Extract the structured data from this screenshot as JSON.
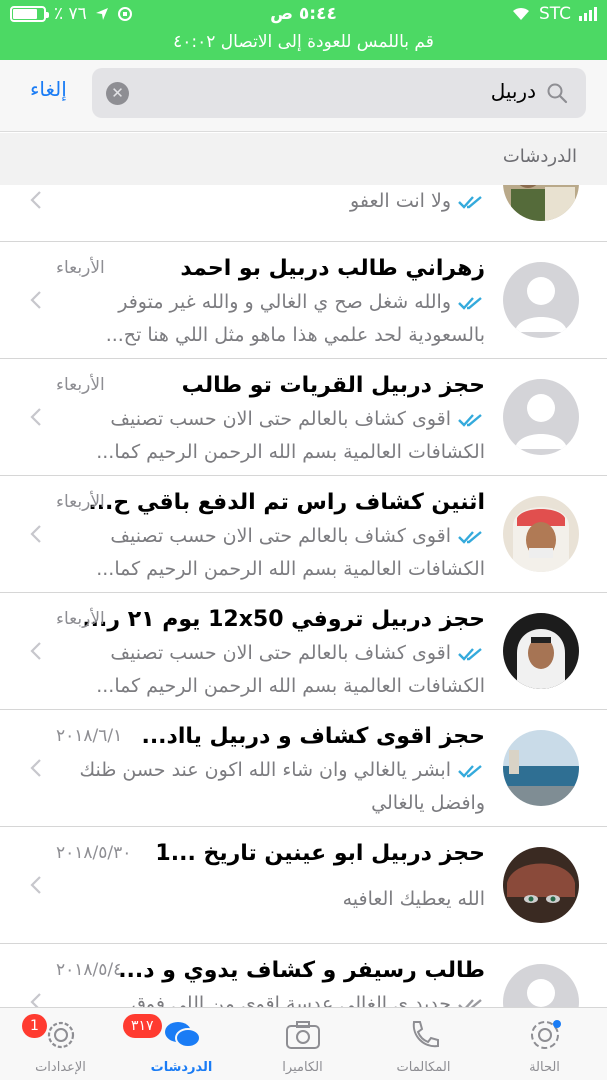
{
  "status_bar": {
    "battery_text": "٪ ٧٦",
    "battery_fraction": 0.76,
    "time": "٥:٤٤ ص",
    "carrier": "STC",
    "call_banner": "قم باللمس للعودة إلى الاتصال ٤٠:٠٢"
  },
  "search": {
    "query": "دربيل",
    "cancel_label": "إلغاء"
  },
  "section": {
    "title": "الدردشات"
  },
  "chats": [
    {
      "name": "",
      "date": "",
      "preview": "ولا انت العفو",
      "read": true
    },
    {
      "name": "زهراني طالب دربيل بو احمد",
      "date": "الأربعاء",
      "preview": "والله شغل صح ي الغالي و والله غير متوفر بالسعودية لحد علمي هذا ماهو مثل اللي هنا تح...",
      "read": true
    },
    {
      "name": "حجز دربيل القريات تو طالب",
      "date": "الأربعاء",
      "preview": "اقوى كشاف بالعالم حتى الان حسب تصنيف الكشافات العالمية بسم الله الرحمن الرحيم كما...",
      "read": true
    },
    {
      "name": "اثنين كشاف راس تم الدفع باقي ح...",
      "date": "الأربعاء",
      "preview": "اقوى كشاف بالعالم حتى الان حسب تصنيف الكشافات العالمية بسم الله الرحمن الرحيم كما...",
      "read": true
    },
    {
      "name": "حجز دربيل تروفي 12x50 يوم ٢١ ر...",
      "date": "الأربعاء",
      "preview": "اقوى كشاف بالعالم حتى الان حسب تصنيف الكشافات العالمية بسم الله الرحمن الرحيم كما...",
      "read": true
    },
    {
      "name": "حجز اقوى كشاف و دربيل يااد...",
      "date": "٢٠١٨/٦/١",
      "preview": "ابشر يالغالي وان شاء الله اكون عند حسن ظنك وافضل يالغالي",
      "read": true
    },
    {
      "name": "حجز دربيل ابو عينين تاريخ ...1",
      "date": "٢٠١٨/٥/٣٠",
      "preview": "الله يعطيك العافيه",
      "read": false
    },
    {
      "name": "طالب رسيفر و كشاف يدوي و د...",
      "date": "٢٠١٨/٥/٤",
      "preview": "حديد ي الغالي عدسة اقوى من اللي فوق",
      "read": false
    }
  ],
  "tabs": [
    {
      "label": "الإعدادات",
      "icon": "gear-icon",
      "badge": "1"
    },
    {
      "label": "الدردشات",
      "icon": "chats-icon",
      "badge": "٣١٧",
      "active": true
    },
    {
      "label": "الكاميرا",
      "icon": "camera-icon"
    },
    {
      "label": "المكالمات",
      "icon": "phone-icon"
    },
    {
      "label": "الحالة",
      "icon": "status-icon"
    }
  ],
  "colors": {
    "status_bar_bg": "#4cd964",
    "accent": "#1a7cf5",
    "badge": "#ff3b30",
    "read_ticks": "#34aadc"
  }
}
